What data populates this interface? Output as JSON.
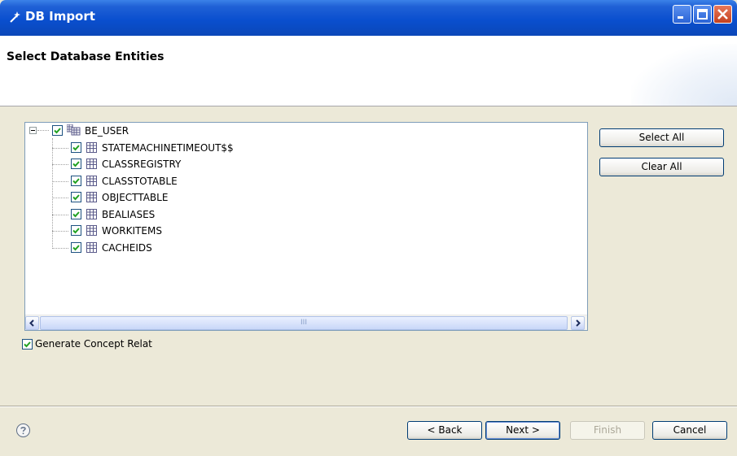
{
  "window": {
    "title": "DB Import",
    "app_icon": "wand-icon"
  },
  "banner": {
    "title": "Select Database Entities"
  },
  "tree": {
    "root": {
      "label": "BE_USER",
      "checked": true,
      "expanded": true,
      "icon": "schema-icon"
    },
    "children": [
      {
        "label": "STATEMACHINETIMEOUT$$",
        "checked": true,
        "icon": "table-icon"
      },
      {
        "label": "CLASSREGISTRY",
        "checked": true,
        "icon": "table-icon"
      },
      {
        "label": "CLASSTOTABLE",
        "checked": true,
        "icon": "table-icon"
      },
      {
        "label": "OBJECTTABLE",
        "checked": true,
        "icon": "table-icon"
      },
      {
        "label": "BEALIASES",
        "checked": true,
        "icon": "table-icon"
      },
      {
        "label": "WORKITEMS",
        "checked": true,
        "icon": "table-icon"
      },
      {
        "label": "CACHEIDS",
        "checked": true,
        "icon": "table-icon"
      }
    ],
    "scroll_thumb_grip": "III"
  },
  "side_buttons": {
    "select_all": "Select All",
    "clear_all": "Clear All"
  },
  "options": {
    "generate_concept_label": "Generate Concept Relat",
    "generate_concept_checked": true
  },
  "footer": {
    "back": "< Back",
    "next": "Next >",
    "finish": "Finish",
    "cancel": "Cancel"
  }
}
